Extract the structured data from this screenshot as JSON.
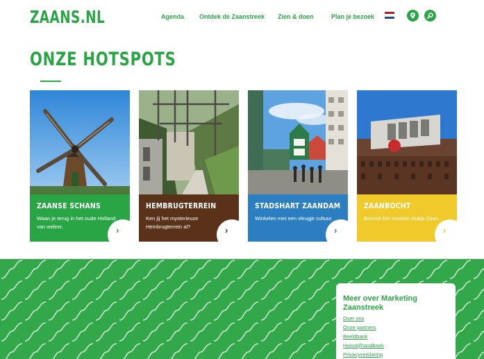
{
  "header": {
    "logo": "ZAANS.NL",
    "nav": [
      "Agenda",
      "Ontdek de Zaanstreek",
      "Zien & doen",
      "Plan je bezoek"
    ],
    "icons": [
      "flag-nl-icon",
      "location-icon",
      "search-icon"
    ]
  },
  "hotspots": {
    "title": "ONZE HOTSPOTS",
    "cards": [
      {
        "title": "ZAANSE SCHANS",
        "text": "Waan je terug in het oude Holland van weleer.",
        "color": "#2aa545"
      },
      {
        "title": "HEMBRUGTERREIN",
        "text": "Ken jij het mysterieuze Hembrugterrein al?",
        "color": "#5a3219"
      },
      {
        "title": "STADSHART ZAANDAM",
        "text": "Winkelen met een vleugje cultuur.",
        "color": "#2b7fc1"
      },
      {
        "title": "ZAANBOCHT",
        "text": "Bezoek het mooiste stukje Zaan.",
        "color": "#f0c92a"
      }
    ],
    "arrow": "›"
  },
  "footer": {
    "title": "Meer over Marketing Zaanstreek",
    "links": [
      "Over ons",
      "Onze partners",
      "Beeldbank",
      "Huisstijlhandboek",
      "Privacyverklaring"
    ]
  },
  "colors": {
    "brand": "#2aa545",
    "brown": "#5a3219",
    "blue": "#2b7fc1",
    "yellow": "#f0c92a"
  }
}
